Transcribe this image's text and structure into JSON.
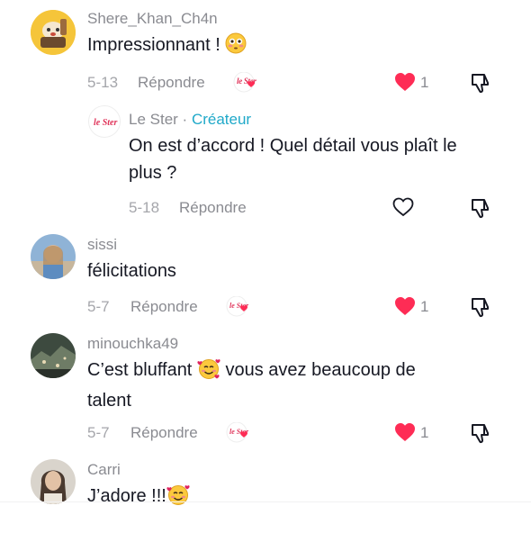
{
  "comments": [
    {
      "username": "Shere_Khan_Ch4n",
      "text": "Impressionnant ! ",
      "date": "5-13",
      "reply_label": "Répondre",
      "likes": "1",
      "liked": true,
      "avatar_icon": "cartoon-character-avatar"
    },
    {
      "username": "Le Ster",
      "separator": "·",
      "creator_badge": "Créateur",
      "text_line1": "On est d’accord ! Quel détail vous plaît le",
      "text_line2": "plus ?",
      "date": "5-18",
      "reply_label": "Répondre",
      "avatar_text": "le Ster",
      "liked": false
    },
    {
      "username": "sissi",
      "text": "félicitations",
      "date": "5-7",
      "reply_label": "Répondre",
      "likes": "1",
      "liked": true
    },
    {
      "username": "minouchka49",
      "text_line1a": "C’est bluffant ",
      "text_line1b": " vous avez beaucoup de",
      "text_line2": "talent",
      "date": "5-7",
      "reply_label": "Répondre",
      "likes": "1",
      "liked": true
    },
    {
      "username": "Carri",
      "text": "J’adore !!!"
    }
  ],
  "creator_like_text": "le Ster",
  "colors": {
    "heart_red": "#fe2c55",
    "creator_accent": "#20a9c9",
    "logo_red": "#e0345a",
    "muted_text": "#8a8b91"
  }
}
